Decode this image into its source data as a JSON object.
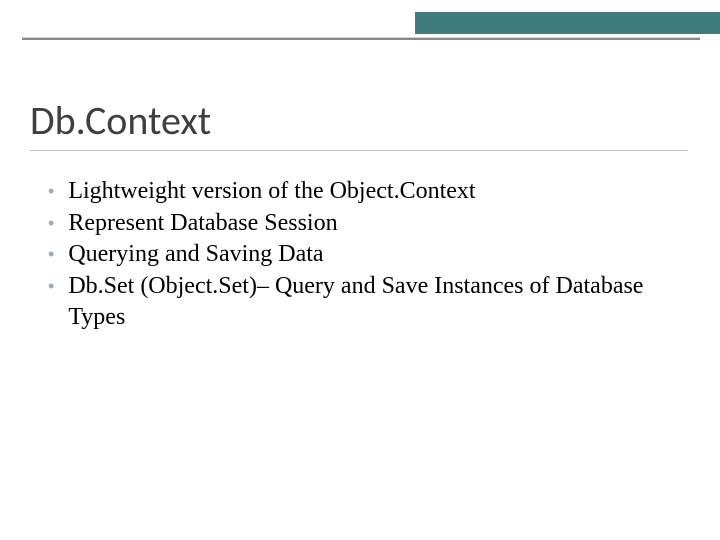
{
  "title": "Db.Context",
  "bullets": [
    "Lightweight version of the Object.Context",
    "Represent Database Session",
    "Querying and Saving Data",
    "Db.Set (Object.Set)– Query and Save Instances of Database Types"
  ],
  "colors": {
    "accent": "#3f7d7d",
    "bullet_dot": "#9ab2b2",
    "title_text": "#3f3f3f"
  }
}
